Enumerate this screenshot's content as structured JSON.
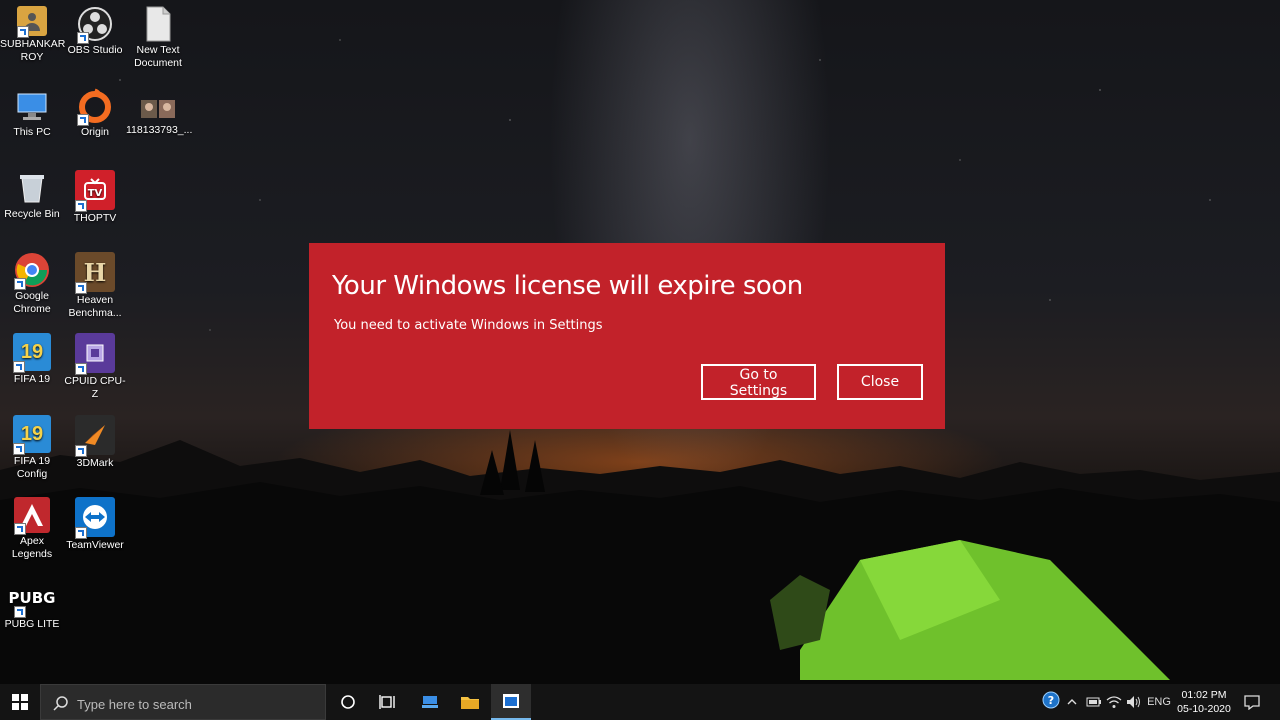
{
  "desktop": {
    "icons": [
      {
        "label": "SUBHANKAR ROY",
        "icon": "user-folder-icon",
        "color": "#d9a441"
      },
      {
        "label": "OBS Studio",
        "icon": "obs-icon",
        "color": "#303030"
      },
      {
        "label": "New Text Document",
        "icon": "text-document-icon",
        "color": "#e8e8e8"
      },
      {
        "label": "This PC",
        "icon": "this-pc-icon",
        "color": "#3a8ee6"
      },
      {
        "label": "Origin",
        "icon": "origin-icon",
        "color": "#f36c21"
      },
      {
        "label": "118133793_...",
        "icon": "image-file-icon",
        "color": "#6b5a4a"
      },
      {
        "label": "Recycle Bin",
        "icon": "recycle-bin-icon",
        "color": "#c8d0d8"
      },
      {
        "label": "THOPTV",
        "icon": "thoptv-icon",
        "color": "#d0202a"
      },
      {
        "label": "Google Chrome",
        "icon": "chrome-icon",
        "color": "#4285f4"
      },
      {
        "label": "Heaven Benchma...",
        "icon": "heaven-benchmark-icon",
        "color": "#6b4a2a"
      },
      {
        "label": "FIFA 19",
        "icon": "fifa-icon",
        "color": "#2a8bd6"
      },
      {
        "label": "CPUID CPU-Z",
        "icon": "cpuz-icon",
        "color": "#5a3a9a"
      },
      {
        "label": "FIFA 19 Config",
        "icon": "fifa-config-icon",
        "color": "#2a8bd6"
      },
      {
        "label": "3DMark",
        "icon": "3dmark-icon",
        "color": "#2b2b2b"
      },
      {
        "label": "Apex Legends",
        "icon": "apex-legends-icon",
        "color": "#c0282d"
      },
      {
        "label": "TeamViewer",
        "icon": "teamviewer-icon",
        "color": "#0e72c9"
      },
      {
        "label": "PUBG LITE",
        "icon": "pubg-lite-icon",
        "color": "#1a1a1a"
      }
    ]
  },
  "dialog": {
    "title": "Your Windows license will expire soon",
    "message": "You need to activate Windows in Settings",
    "primary_label": "Go to Settings",
    "close_label": "Close",
    "bg_color": "#c2222a"
  },
  "taskbar": {
    "search_placeholder": "Type here to search",
    "pinned": [
      "cortana-icon",
      "task-view-icon",
      "app-icon",
      "file-explorer-icon",
      "active-app-icon"
    ],
    "tray": {
      "language": "ENG",
      "time": "01:02 PM",
      "date": "05-10-2020"
    }
  }
}
